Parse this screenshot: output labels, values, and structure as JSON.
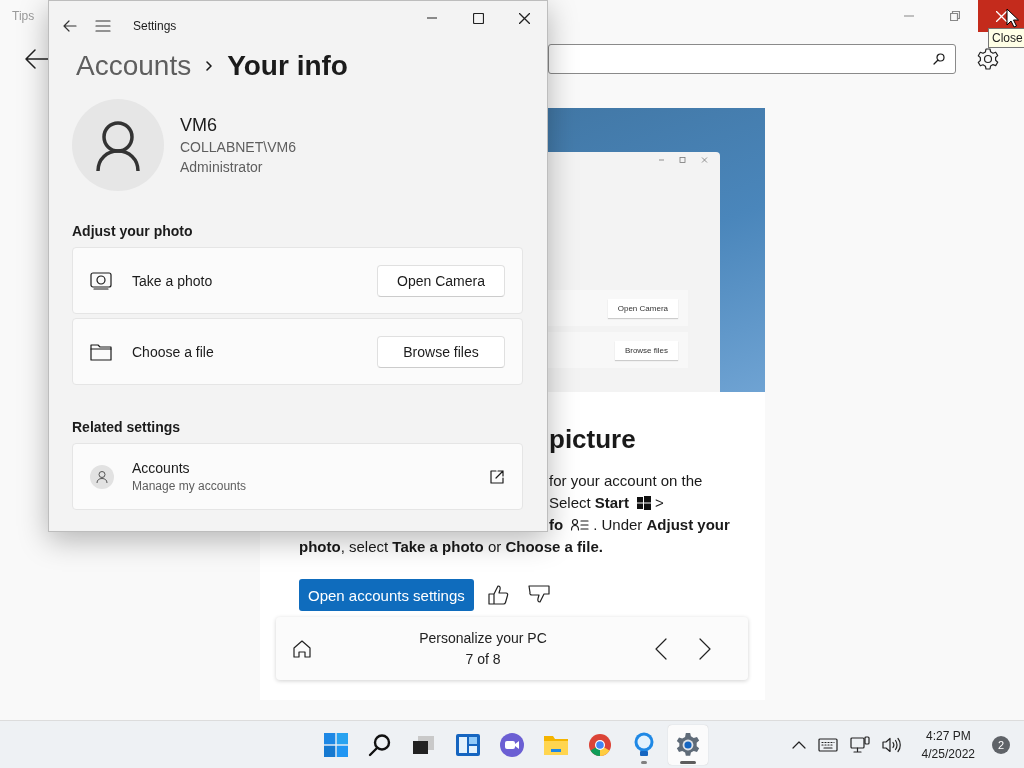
{
  "tips_window": {
    "title": "Tips",
    "close_hovered": true,
    "tooltip": "Close",
    "illustration": {
      "buttons": [
        "Open Camera",
        "Browse files"
      ]
    },
    "heading": "picture",
    "line_ends": [
      {
        "kind": "text",
        "before": "for your account on the"
      },
      {
        "kind": "start",
        "before": "Select **Start**",
        "after": ">"
      },
      {
        "kind": "info",
        "before": "**fo**",
        "after": ". Under **Adjust your**"
      }
    ],
    "last_line": "**photo**, select **Take a photo** or **Choose a file.**",
    "action_button": "Open accounts settings",
    "nav": {
      "title": "Personalize your PC",
      "position": "7 of 8"
    }
  },
  "settings_window": {
    "title": "Settings",
    "breadcrumb": [
      "Accounts",
      "Your info"
    ],
    "profile": {
      "name": "VM6",
      "account": "COLLABNET\\VM6",
      "role": "Administrator"
    },
    "sections": [
      {
        "heading": "Adjust your photo",
        "rows": [
          {
            "kind": "camera",
            "label": "Take a photo",
            "button": "Open Camera"
          },
          {
            "kind": "folder",
            "label": "Choose a file",
            "button": "Browse files"
          }
        ]
      },
      {
        "heading": "Related settings",
        "rows": [
          {
            "kind": "link",
            "label": "Accounts",
            "description": "Manage my accounts"
          }
        ]
      }
    ]
  },
  "taskbar": {
    "apps": [
      {
        "kind": "start",
        "running": false,
        "selected": false
      },
      {
        "kind": "search",
        "running": false,
        "selected": false
      },
      {
        "kind": "taskview",
        "running": false,
        "selected": false
      },
      {
        "kind": "widgets",
        "running": false,
        "selected": false
      },
      {
        "kind": "chat",
        "running": false,
        "selected": false
      },
      {
        "kind": "folder",
        "running": false,
        "selected": false
      },
      {
        "kind": "browser",
        "running": false,
        "selected": false
      },
      {
        "kind": "bulb",
        "running": true,
        "selected": false
      },
      {
        "kind": "gear",
        "running": true,
        "selected": true
      }
    ],
    "time": "4:27 PM",
    "date": "4/25/2022",
    "notifications": "2"
  }
}
